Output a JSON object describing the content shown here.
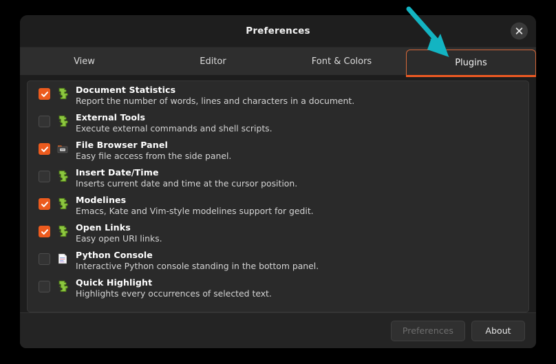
{
  "window": {
    "title": "Preferences",
    "close_icon": "close-icon"
  },
  "tabs": [
    {
      "label": "View",
      "selected": false
    },
    {
      "label": "Editor",
      "selected": false
    },
    {
      "label": "Font & Colors",
      "selected": false
    },
    {
      "label": "Plugins",
      "selected": true
    }
  ],
  "plugins": [
    {
      "name": "Document Statistics",
      "description": "Report the number of words, lines and characters in a document.",
      "enabled": true,
      "icon": "puzzle-piece-icon"
    },
    {
      "name": "External Tools",
      "description": "Execute external commands and shell scripts.",
      "enabled": false,
      "icon": "puzzle-piece-icon"
    },
    {
      "name": "File Browser Panel",
      "description": "Easy file access from the side panel.",
      "enabled": true,
      "icon": "folder-icon"
    },
    {
      "name": "Insert Date/Time",
      "description": "Inserts current date and time at the cursor position.",
      "enabled": false,
      "icon": "puzzle-piece-icon"
    },
    {
      "name": "Modelines",
      "description": "Emacs, Kate and Vim-style modelines support for gedit.",
      "enabled": true,
      "icon": "puzzle-piece-icon"
    },
    {
      "name": "Open Links",
      "description": "Easy open URI links.",
      "enabled": true,
      "icon": "puzzle-piece-icon"
    },
    {
      "name": "Python Console",
      "description": "Interactive Python console standing in the bottom panel.",
      "enabled": false,
      "icon": "document-icon"
    },
    {
      "name": "Quick Highlight",
      "description": "Highlights every occurrences of selected text.",
      "enabled": false,
      "icon": "puzzle-piece-icon"
    }
  ],
  "footer": {
    "preferences_label": "Preferences",
    "preferences_enabled": false,
    "about_label": "About",
    "about_enabled": true
  },
  "annotation": {
    "type": "arrow",
    "points_to": "Plugins",
    "color": "#13b4c2"
  },
  "colors": {
    "accent_orange": "#f05a22",
    "checkbox_orange": "#ec5b1e",
    "annotation_teal": "#13b4c2",
    "dialog_bg": "#1d1d1d",
    "list_bg": "#2a2a2a",
    "tabbar_bg": "#2e2e2e",
    "titlebar_bg": "#1e1e1e",
    "page_bg": "#000000"
  }
}
